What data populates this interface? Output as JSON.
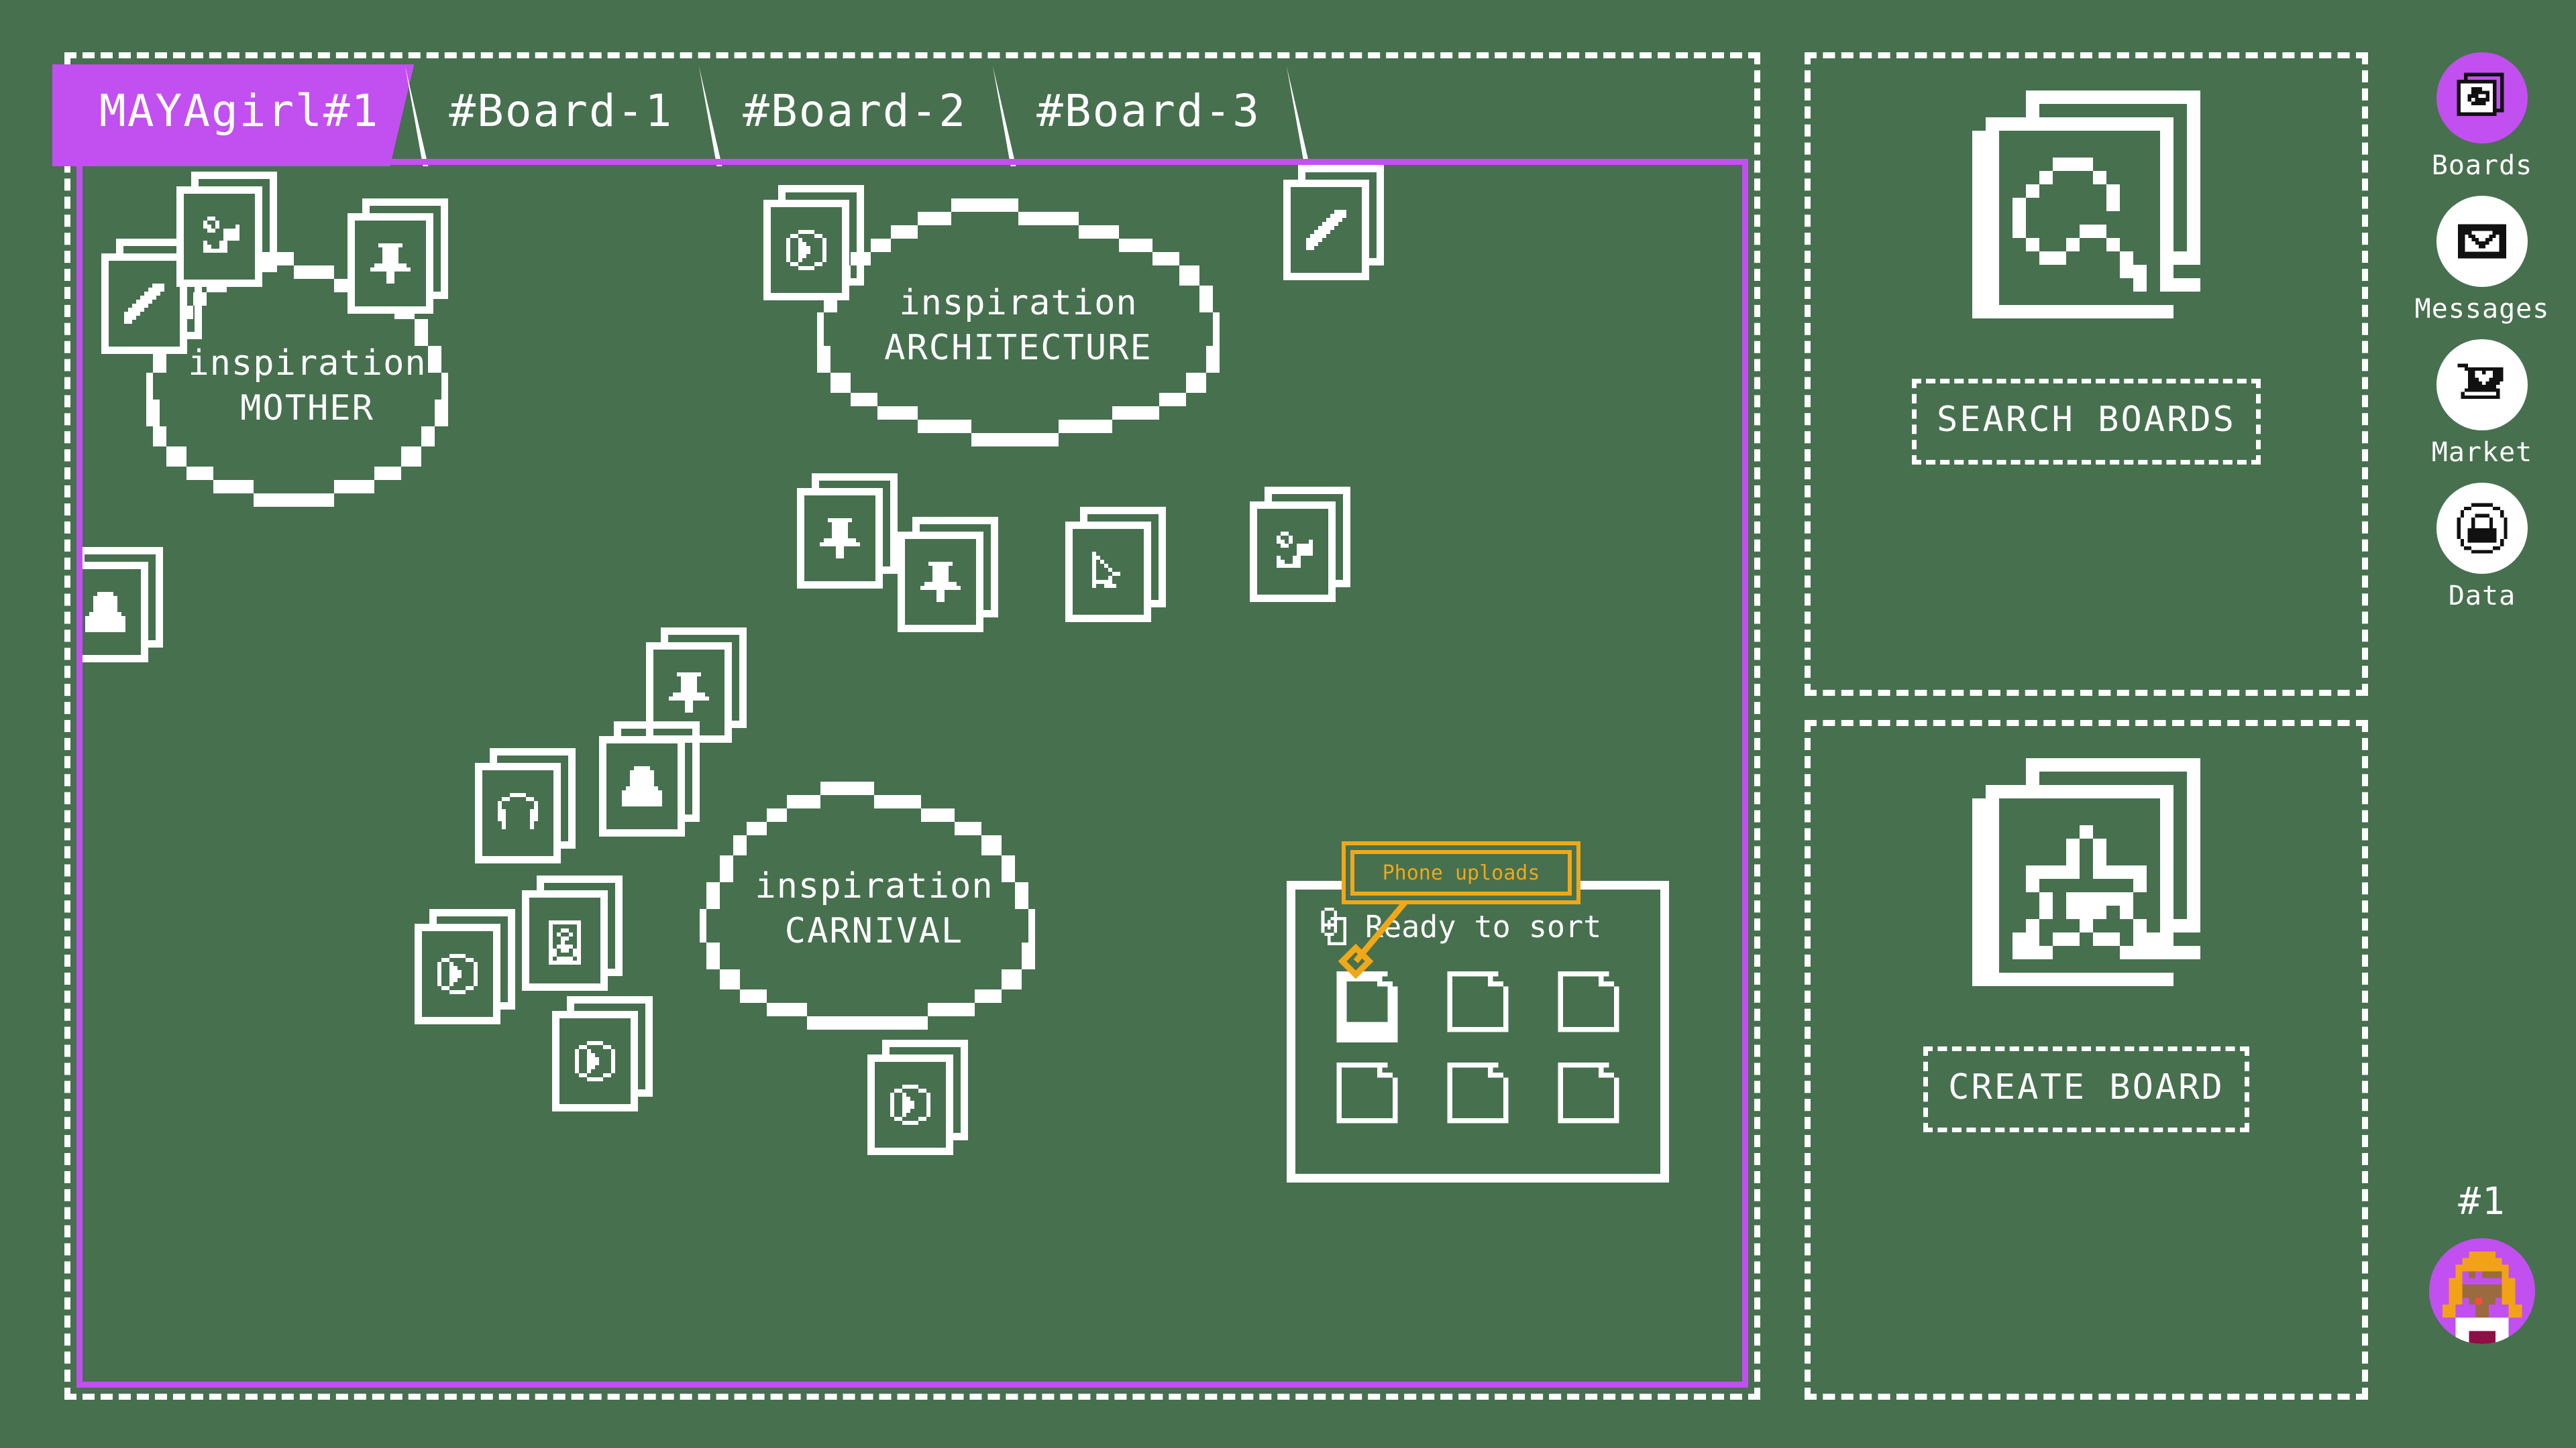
{
  "theme": {
    "background": "#47704f",
    "accent_purple": "#c24ff0",
    "white": "#ffffff",
    "tooltip_orange": "#f0a818"
  },
  "board_panel": {
    "tabs": [
      {
        "label": "MAYAgirl#1",
        "active": true
      },
      {
        "label": "#Board-1",
        "active": false
      },
      {
        "label": "#Board-2",
        "active": false
      },
      {
        "label": "#Board-3",
        "active": false
      }
    ],
    "clouds": [
      {
        "line1": "inspiration",
        "line2": "MOTHER"
      },
      {
        "line1": "inspiration",
        "line2": "ARCHITECTURE"
      },
      {
        "line1": "inspiration",
        "line2": "CARNIVAL"
      }
    ],
    "cards": [
      {
        "icon": "pencil-icon"
      },
      {
        "icon": "photo-flower-icon"
      },
      {
        "icon": "pushpin-icon"
      },
      {
        "icon": "person-icon"
      },
      {
        "icon": "play-icon"
      },
      {
        "icon": "pencil-icon"
      },
      {
        "icon": "pushpin-icon"
      },
      {
        "icon": "pushpin-icon"
      },
      {
        "icon": "cursor-icon"
      },
      {
        "icon": "photo-flower-icon"
      },
      {
        "icon": "pushpin-icon"
      },
      {
        "icon": "headphones-icon"
      },
      {
        "icon": "person-icon"
      },
      {
        "icon": "speaker-icon"
      },
      {
        "icon": "play-icon"
      },
      {
        "icon": "play-icon"
      },
      {
        "icon": "play-icon"
      }
    ],
    "uploads": {
      "tooltip_label": "Phone uploads",
      "status_label": "Ready to sort",
      "file_count": 6
    }
  },
  "side_panels": [
    {
      "icon": "search-boards-icon",
      "button_label": "SEARCH BOARDS"
    },
    {
      "icon": "create-board-icon",
      "button_label": "CREATE BOARD"
    }
  ],
  "rail": {
    "items": [
      {
        "label": "Boards",
        "icon": "boards-icon",
        "active": true
      },
      {
        "label": "Messages",
        "icon": "envelope-icon",
        "active": false
      },
      {
        "label": "Market",
        "icon": "cart-heart-icon",
        "active": false
      },
      {
        "label": "Data",
        "icon": "lock-circle-icon",
        "active": false
      }
    ],
    "user": {
      "rank": "#1",
      "avatar": "user-avatar"
    }
  }
}
